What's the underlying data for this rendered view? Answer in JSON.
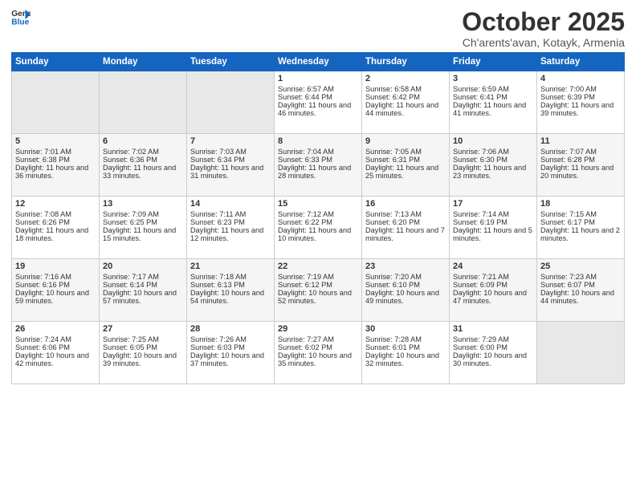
{
  "header": {
    "logo_general": "General",
    "logo_blue": "Blue",
    "month_title": "October 2025",
    "location": "Ch'arents'avan, Kotayk, Armenia"
  },
  "days_of_week": [
    "Sunday",
    "Monday",
    "Tuesday",
    "Wednesday",
    "Thursday",
    "Friday",
    "Saturday"
  ],
  "weeks": [
    [
      {
        "day": "",
        "empty": true
      },
      {
        "day": "",
        "empty": true
      },
      {
        "day": "",
        "empty": true
      },
      {
        "day": "1",
        "sunrise": "Sunrise: 6:57 AM",
        "sunset": "Sunset: 6:44 PM",
        "daylight": "Daylight: 11 hours and 46 minutes."
      },
      {
        "day": "2",
        "sunrise": "Sunrise: 6:58 AM",
        "sunset": "Sunset: 6:42 PM",
        "daylight": "Daylight: 11 hours and 44 minutes."
      },
      {
        "day": "3",
        "sunrise": "Sunrise: 6:59 AM",
        "sunset": "Sunset: 6:41 PM",
        "daylight": "Daylight: 11 hours and 41 minutes."
      },
      {
        "day": "4",
        "sunrise": "Sunrise: 7:00 AM",
        "sunset": "Sunset: 6:39 PM",
        "daylight": "Daylight: 11 hours and 39 minutes."
      }
    ],
    [
      {
        "day": "5",
        "sunrise": "Sunrise: 7:01 AM",
        "sunset": "Sunset: 6:38 PM",
        "daylight": "Daylight: 11 hours and 36 minutes."
      },
      {
        "day": "6",
        "sunrise": "Sunrise: 7:02 AM",
        "sunset": "Sunset: 6:36 PM",
        "daylight": "Daylight: 11 hours and 33 minutes."
      },
      {
        "day": "7",
        "sunrise": "Sunrise: 7:03 AM",
        "sunset": "Sunset: 6:34 PM",
        "daylight": "Daylight: 11 hours and 31 minutes."
      },
      {
        "day": "8",
        "sunrise": "Sunrise: 7:04 AM",
        "sunset": "Sunset: 6:33 PM",
        "daylight": "Daylight: 11 hours and 28 minutes."
      },
      {
        "day": "9",
        "sunrise": "Sunrise: 7:05 AM",
        "sunset": "Sunset: 6:31 PM",
        "daylight": "Daylight: 11 hours and 25 minutes."
      },
      {
        "day": "10",
        "sunrise": "Sunrise: 7:06 AM",
        "sunset": "Sunset: 6:30 PM",
        "daylight": "Daylight: 11 hours and 23 minutes."
      },
      {
        "day": "11",
        "sunrise": "Sunrise: 7:07 AM",
        "sunset": "Sunset: 6:28 PM",
        "daylight": "Daylight: 11 hours and 20 minutes."
      }
    ],
    [
      {
        "day": "12",
        "sunrise": "Sunrise: 7:08 AM",
        "sunset": "Sunset: 6:26 PM",
        "daylight": "Daylight: 11 hours and 18 minutes."
      },
      {
        "day": "13",
        "sunrise": "Sunrise: 7:09 AM",
        "sunset": "Sunset: 6:25 PM",
        "daylight": "Daylight: 11 hours and 15 minutes."
      },
      {
        "day": "14",
        "sunrise": "Sunrise: 7:11 AM",
        "sunset": "Sunset: 6:23 PM",
        "daylight": "Daylight: 11 hours and 12 minutes."
      },
      {
        "day": "15",
        "sunrise": "Sunrise: 7:12 AM",
        "sunset": "Sunset: 6:22 PM",
        "daylight": "Daylight: 11 hours and 10 minutes."
      },
      {
        "day": "16",
        "sunrise": "Sunrise: 7:13 AM",
        "sunset": "Sunset: 6:20 PM",
        "daylight": "Daylight: 11 hours and 7 minutes."
      },
      {
        "day": "17",
        "sunrise": "Sunrise: 7:14 AM",
        "sunset": "Sunset: 6:19 PM",
        "daylight": "Daylight: 11 hours and 5 minutes."
      },
      {
        "day": "18",
        "sunrise": "Sunrise: 7:15 AM",
        "sunset": "Sunset: 6:17 PM",
        "daylight": "Daylight: 11 hours and 2 minutes."
      }
    ],
    [
      {
        "day": "19",
        "sunrise": "Sunrise: 7:16 AM",
        "sunset": "Sunset: 6:16 PM",
        "daylight": "Daylight: 10 hours and 59 minutes."
      },
      {
        "day": "20",
        "sunrise": "Sunrise: 7:17 AM",
        "sunset": "Sunset: 6:14 PM",
        "daylight": "Daylight: 10 hours and 57 minutes."
      },
      {
        "day": "21",
        "sunrise": "Sunrise: 7:18 AM",
        "sunset": "Sunset: 6:13 PM",
        "daylight": "Daylight: 10 hours and 54 minutes."
      },
      {
        "day": "22",
        "sunrise": "Sunrise: 7:19 AM",
        "sunset": "Sunset: 6:12 PM",
        "daylight": "Daylight: 10 hours and 52 minutes."
      },
      {
        "day": "23",
        "sunrise": "Sunrise: 7:20 AM",
        "sunset": "Sunset: 6:10 PM",
        "daylight": "Daylight: 10 hours and 49 minutes."
      },
      {
        "day": "24",
        "sunrise": "Sunrise: 7:21 AM",
        "sunset": "Sunset: 6:09 PM",
        "daylight": "Daylight: 10 hours and 47 minutes."
      },
      {
        "day": "25",
        "sunrise": "Sunrise: 7:23 AM",
        "sunset": "Sunset: 6:07 PM",
        "daylight": "Daylight: 10 hours and 44 minutes."
      }
    ],
    [
      {
        "day": "26",
        "sunrise": "Sunrise: 7:24 AM",
        "sunset": "Sunset: 6:06 PM",
        "daylight": "Daylight: 10 hours and 42 minutes."
      },
      {
        "day": "27",
        "sunrise": "Sunrise: 7:25 AM",
        "sunset": "Sunset: 6:05 PM",
        "daylight": "Daylight: 10 hours and 39 minutes."
      },
      {
        "day": "28",
        "sunrise": "Sunrise: 7:26 AM",
        "sunset": "Sunset: 6:03 PM",
        "daylight": "Daylight: 10 hours and 37 minutes."
      },
      {
        "day": "29",
        "sunrise": "Sunrise: 7:27 AM",
        "sunset": "Sunset: 6:02 PM",
        "daylight": "Daylight: 10 hours and 35 minutes."
      },
      {
        "day": "30",
        "sunrise": "Sunrise: 7:28 AM",
        "sunset": "Sunset: 6:01 PM",
        "daylight": "Daylight: 10 hours and 32 minutes."
      },
      {
        "day": "31",
        "sunrise": "Sunrise: 7:29 AM",
        "sunset": "Sunset: 6:00 PM",
        "daylight": "Daylight: 10 hours and 30 minutes."
      },
      {
        "day": "",
        "empty": true
      }
    ]
  ]
}
